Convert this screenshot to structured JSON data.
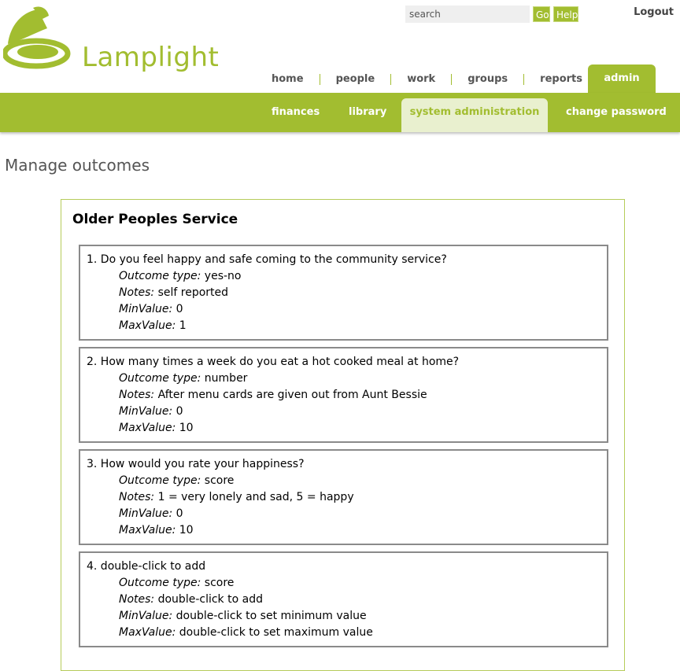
{
  "header": {
    "logo_text": "Lamplight",
    "search_placeholder": "search",
    "go_label": "Go",
    "help_label": "Help",
    "logout_label": "Logout"
  },
  "main_nav": [
    {
      "label": "home"
    },
    {
      "label": "people"
    },
    {
      "label": "work"
    },
    {
      "label": "groups"
    },
    {
      "label": "reports"
    }
  ],
  "admin_tab": "admin",
  "sub_nav": {
    "finances": "finances",
    "library": "library",
    "system_administration": "system administration",
    "change_password": "change password"
  },
  "page_title": "Manage outcomes",
  "panel": {
    "title": "Older Peoples Service",
    "labels": {
      "type": "Outcome type:",
      "notes": "Notes:",
      "min": "MinValue:",
      "max": "MaxValue:"
    },
    "outcomes": [
      {
        "question": "1. Do you feel happy and safe coming to the community service?",
        "type": "yes-no",
        "notes": "self reported",
        "min": "0",
        "max": "1"
      },
      {
        "question": "2. How many times a week do you eat a hot cooked meal at home?",
        "type": "number",
        "notes": "After menu cards are given out from Aunt Bessie",
        "min": "0",
        "max": "10"
      },
      {
        "question": "3. How would you rate your happiness?",
        "type": "score",
        "notes": "1 = very lonely and sad, 5 = happy",
        "min": "0",
        "max": "10"
      },
      {
        "question": "4. double-click to add",
        "type": "score",
        "notes": "double-click to add",
        "min": "double-click to set minimum value",
        "max": "double-click to set maximum value"
      }
    ]
  },
  "colors": {
    "brand_green": "#a2bd30",
    "active_tab_bg": "#e9f0cf",
    "box_border": "#8a8a8a"
  }
}
